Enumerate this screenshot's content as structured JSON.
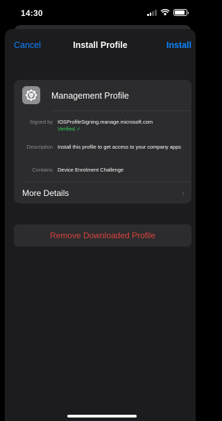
{
  "status_bar": {
    "time": "14:30",
    "icons": [
      "signal-icon",
      "wifi-icon",
      "battery-icon"
    ]
  },
  "nav": {
    "cancel_label": "Cancel",
    "title": "Install Profile",
    "install_label": "Install"
  },
  "profile": {
    "icon": "gear-icon",
    "name": "Management Profile",
    "rows": [
      {
        "label": "Signed by",
        "value": "IOSProfileSigning.manage.microsoft.com",
        "status": "Verified ✓"
      },
      {
        "label": "Description",
        "value": "Install this profile to get access to your company apps"
      },
      {
        "label": "Contains",
        "value": "Device Enrolment Challenge"
      }
    ],
    "more_details_label": "More Details",
    "more_details_icon": "chevron-right-icon"
  },
  "remove_button_label": "Remove Downloaded Profile",
  "colors": {
    "accent": "#0a84ff",
    "verified": "#30d158",
    "destructive": "#d9423c",
    "sheet_bg": "#1c1c1e",
    "card_bg": "#2c2c2e"
  }
}
